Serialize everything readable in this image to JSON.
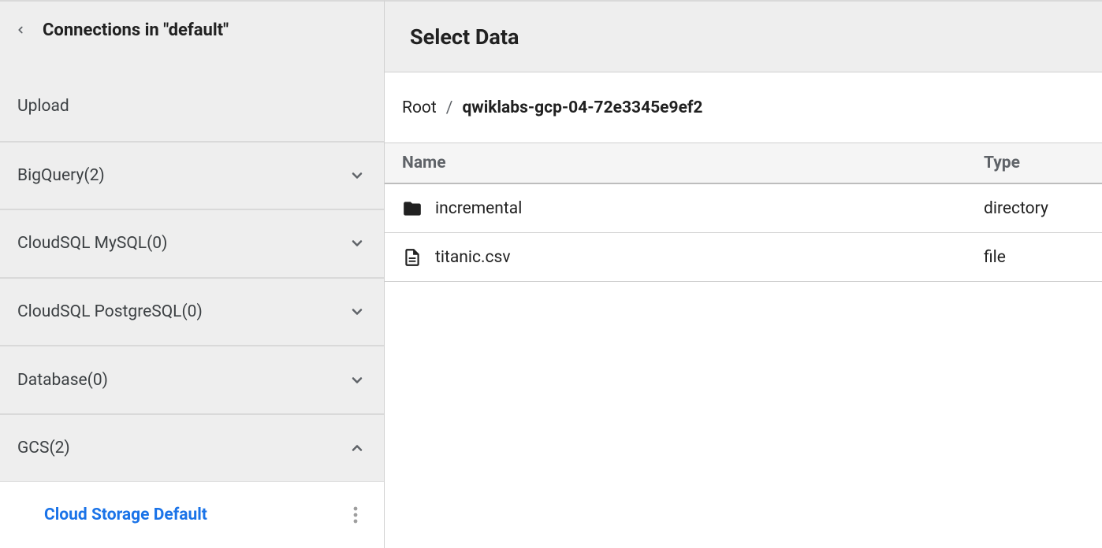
{
  "sidebar": {
    "title": "Connections in \"default\"",
    "upload_label": "Upload",
    "items": [
      {
        "label": "BigQuery(2)",
        "expanded": false
      },
      {
        "label": "CloudSQL MySQL(0)",
        "expanded": false
      },
      {
        "label": "CloudSQL PostgreSQL(0)",
        "expanded": false
      },
      {
        "label": "Database(0)",
        "expanded": false
      },
      {
        "label": "GCS(2)",
        "expanded": true
      }
    ],
    "gcs_subitem": "Cloud Storage Default"
  },
  "main": {
    "title": "Select Data",
    "breadcrumb": {
      "root": "Root",
      "separator": "/",
      "current": "qwiklabs-gcp-04-72e3345e9ef2"
    },
    "columns": {
      "name": "Name",
      "type": "Type"
    },
    "rows": [
      {
        "icon": "folder",
        "name": "incremental",
        "type": "directory"
      },
      {
        "icon": "file",
        "name": "titanic.csv",
        "type": "file"
      }
    ]
  }
}
